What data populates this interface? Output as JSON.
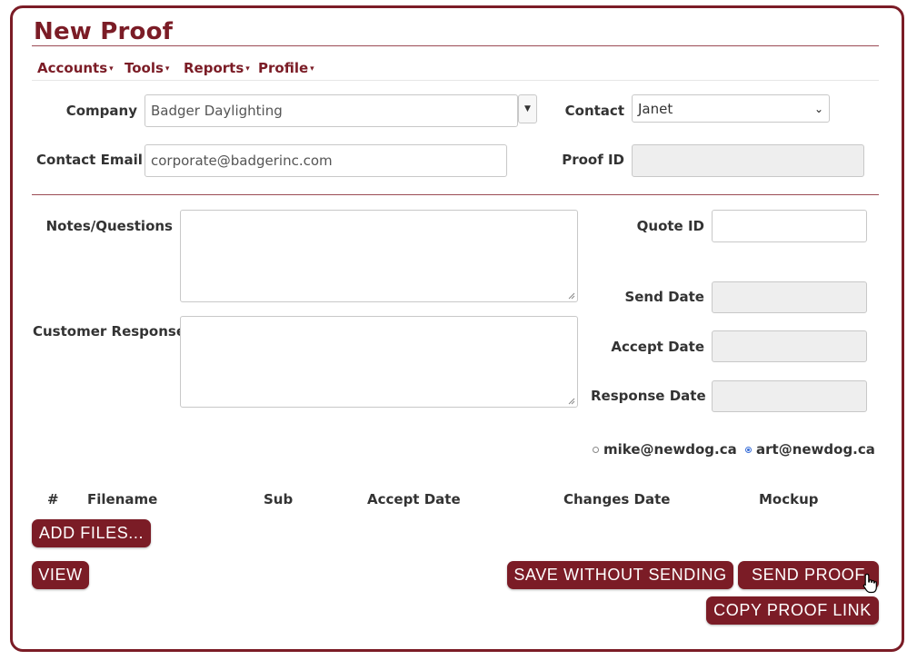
{
  "page": {
    "title": "New Proof"
  },
  "menu": [
    {
      "label": "Accounts"
    },
    {
      "label": "Tools"
    },
    {
      "label": "Reports"
    },
    {
      "label": "Profile"
    }
  ],
  "form": {
    "company": {
      "label": "Company",
      "value": "Badger Daylighting"
    },
    "contact": {
      "label": "Contact",
      "value": "Janet"
    },
    "contact_email": {
      "label": "Contact Email",
      "value": "corporate@badgerinc.com"
    },
    "proof_id": {
      "label": "Proof ID",
      "value": ""
    },
    "notes": {
      "label": "Notes/Questions",
      "value": ""
    },
    "customer_response": {
      "label": "Customer Response",
      "value": ""
    },
    "quote_id": {
      "label": "Quote ID",
      "value": ""
    },
    "send_date": {
      "label": "Send Date",
      "value": ""
    },
    "accept_date": {
      "label": "Accept Date",
      "value": ""
    },
    "response_date": {
      "label": "Response Date",
      "value": ""
    }
  },
  "senders": [
    {
      "label": "mike@newdog.ca",
      "selected": false
    },
    {
      "label": "art@newdog.ca",
      "selected": true
    }
  ],
  "files_table": {
    "columns": [
      "#",
      "Filename",
      "Sub",
      "Accept Date",
      "Changes Date",
      "Mockup"
    ]
  },
  "buttons": {
    "add_files": "ADD FILES...",
    "view": "VIEW",
    "save_without_sending": "SAVE WITHOUT SENDING",
    "send_proof": "SEND PROOF",
    "copy_proof_link": "COPY PROOF LINK"
  },
  "colors": {
    "accent": "#7b1c26",
    "readonly_bg": "#eeeeee",
    "radio_selected": "#3a6fd8"
  },
  "icons": {
    "dropdown": "caret-down-icon",
    "cursor": "hand-pointer-icon"
  }
}
